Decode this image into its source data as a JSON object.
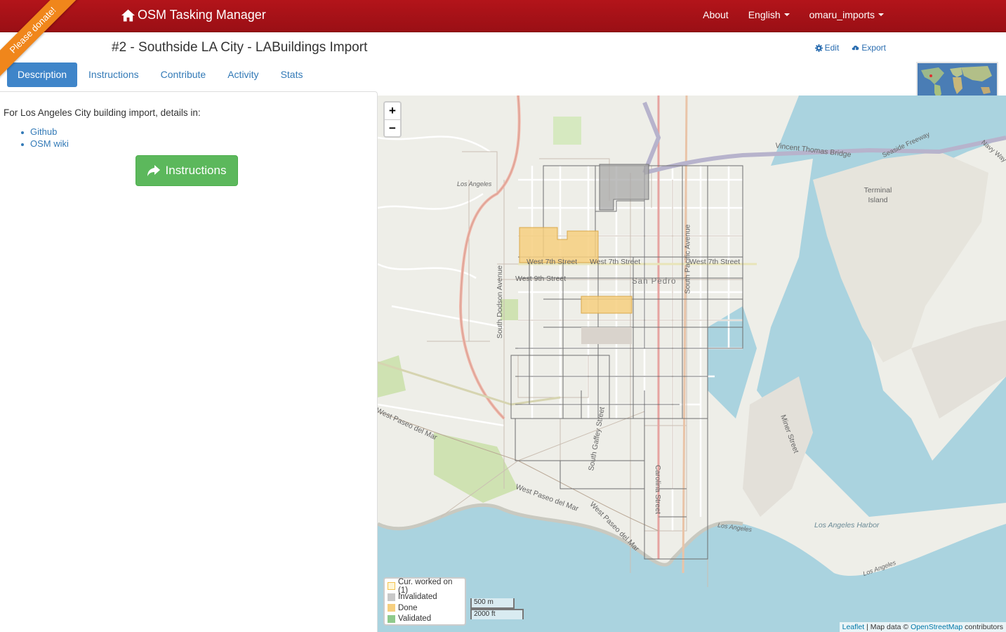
{
  "navbar": {
    "brand": "OSM Tasking Manager",
    "about": "About",
    "language": "English",
    "user": "omaru_imports"
  },
  "ribbon": "Please donate!",
  "project": {
    "title": "#2 - Southside LA City - LABuildings Import",
    "edit": "Edit",
    "export": "Export"
  },
  "tabs": [
    "Description",
    "Instructions",
    "Contribute",
    "Activity",
    "Stats"
  ],
  "description": {
    "text": "For Los Angeles City building import, details in:",
    "links": [
      "Github",
      "OSM wiki"
    ],
    "button": "Instructions"
  },
  "map": {
    "zoom_in": "+",
    "zoom_out": "−",
    "legend": [
      {
        "label": "Cur. worked on (1)",
        "color": "#fff6d6",
        "border": "#f3c34f"
      },
      {
        "label": "Invalidated",
        "color": "#c8c8c8",
        "border": "#bbbbbb"
      },
      {
        "label": "Done",
        "color": "#f6cf7f",
        "border": "#f6cf7f"
      },
      {
        "label": "Validated",
        "color": "#8fca8c",
        "border": "#8fca8c"
      }
    ],
    "scale_metric": "500 m",
    "scale_imperial": "2000 ft",
    "attribution": {
      "leaflet": "Leaflet",
      "sep": " | Map data © ",
      "osm": "OpenStreetMap",
      "suffix": " contributors"
    },
    "labels": {
      "w7_a": "West 7th Street",
      "w7_b": "West 7th Street",
      "w7_c": "West 7th Street",
      "w9": "West 9th Street",
      "san_pedro": "San Pedro",
      "terminal_island": "Terminal Island",
      "vtb": "Vincent Thomas Bridge",
      "seaside": "Seaside Freeway",
      "navy_way": "Navy Way",
      "la_harbor": "Los Angeles Harbor",
      "los_angeles_1": "Los Angeles",
      "los_angeles_2": "Los Angeles",
      "los_angeles_3": "Los Angeles",
      "miner": "Miner Street",
      "carolina": "Carolina Street",
      "south_gaffey": "South Gaffey Street",
      "south_dodson": "South Dodson Avenue",
      "south_pacific": "South Pacific Avenue",
      "paseo_1": "West Paseo del Mar",
      "paseo_2": "West Paseo del Mar",
      "paseo_3": "West Paseo del Mar"
    }
  },
  "colors": {
    "navbar": "#a3111a",
    "accent": "#337ab7",
    "tab_active": "#3f85c9",
    "button_green": "#5cb85c",
    "ribbon": "#f0861b",
    "water": "#aad3df",
    "land": "#eeeee8"
  }
}
